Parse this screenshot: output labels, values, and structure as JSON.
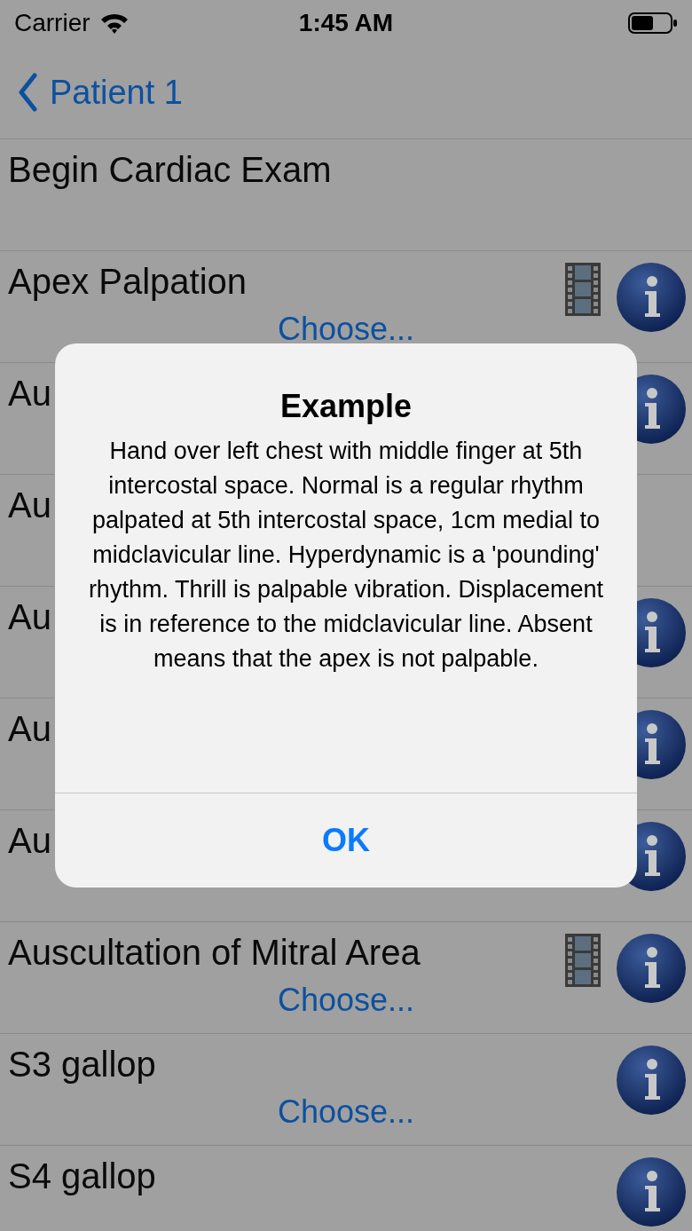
{
  "status_bar": {
    "carrier": "Carrier",
    "time": "1:45 AM"
  },
  "nav": {
    "back": "Patient 1"
  },
  "rows": [
    {
      "label": "Begin Cardiac Exam",
      "icons": []
    },
    {
      "label": "Apex Palpation",
      "icons": [
        {
          "kind": "film"
        },
        {
          "kind": "info"
        }
      ],
      "choose": "Choose..."
    },
    {
      "label": "Au",
      "icons": [
        {
          "kind": "info"
        }
      ]
    },
    {
      "label": "Au",
      "icons": []
    },
    {
      "label": "Au",
      "icons": [
        {
          "kind": "info"
        }
      ]
    },
    {
      "label": "Au",
      "icons": [
        {
          "kind": "info"
        }
      ]
    },
    {
      "label": "Au",
      "icons": [
        {
          "kind": "info"
        }
      ]
    },
    {
      "label": "Auscultation of Mitral Area",
      "icons": [
        {
          "kind": "film"
        },
        {
          "kind": "info"
        }
      ],
      "choose": "Choose..."
    },
    {
      "label": "S3 gallop",
      "icons": [
        {
          "kind": "info"
        }
      ],
      "choose": "Choose..."
    },
    {
      "label": "S4 gallop",
      "icons": [
        {
          "kind": "info"
        }
      ]
    }
  ],
  "alert": {
    "title": "Example",
    "message": "Hand over left chest with middle finger at 5th intercostal space.  Normal is a regular rhythm palpated at 5th intercostal space, 1cm medial to midclavicular line.  Hyperdynamic is a 'pounding' rhythm.  Thrill is palpable vibration. Displacement is in reference to the midclavicular line. Absent means that the apex is not palpable.",
    "button": "OK"
  }
}
